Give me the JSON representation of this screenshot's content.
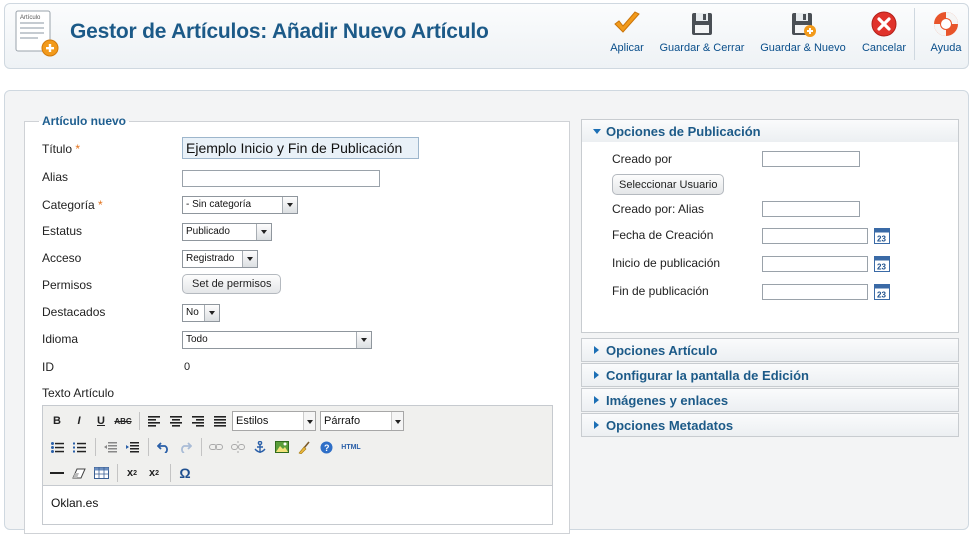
{
  "header": {
    "title": "Gestor de Artículos: Añadir Nuevo Artículo",
    "page_icon_text": "Artículo",
    "toolbar": [
      {
        "id": "apply",
        "label": "Aplicar",
        "icon": "check-icon",
        "color": "#f29a1b"
      },
      {
        "id": "save-close",
        "label": "Guardar & Cerrar",
        "icon": "save-icon"
      },
      {
        "id": "save-new",
        "label": "Guardar & Nuevo",
        "icon": "save-new-icon"
      },
      {
        "id": "cancel",
        "label": "Cancelar",
        "icon": "cancel-icon",
        "color": "#e0322b"
      },
      {
        "id": "help",
        "label": "Ayuda",
        "icon": "lifebuoy-icon",
        "color": "#e8542a"
      }
    ]
  },
  "form": {
    "legend": "Artículo nuevo",
    "title_label": "Título",
    "title_value": "Ejemplo Inicio y Fin de Publicación",
    "alias_label": "Alias",
    "alias_value": "",
    "category_label": "Categoría",
    "category_value": "- Sin categoría",
    "status_label": "Estatus",
    "status_value": "Publicado",
    "access_label": "Acceso",
    "access_value": "Registrado",
    "permissions_label": "Permisos",
    "permissions_button": "Set de permisos",
    "featured_label": "Destacados",
    "featured_value": "No",
    "language_label": "Idioma",
    "language_value": "Todo",
    "id_label": "ID",
    "id_value": "0",
    "article_text_label": "Texto Artículo",
    "required_mark": "*"
  },
  "editor": {
    "styles_select": "Estilos",
    "format_select": "Párrafo",
    "html_label": "HTML",
    "content": "Oklan.es"
  },
  "publishing": {
    "heading": "Opciones de Publicación",
    "created_by_label": "Creado por",
    "select_user_button": "Seleccionar Usuario",
    "created_by_alias_label": "Creado por: Alias",
    "created_date_label": "Fecha de Creación",
    "publish_up_label": "Inicio de publicación",
    "publish_down_label": "Fin de publicación",
    "calendar_text": "23"
  },
  "collapsed_panels": [
    {
      "label": "Opciones Artículo"
    },
    {
      "label": "Configurar la pantalla de Edición"
    },
    {
      "label": "Imágenes y enlaces"
    },
    {
      "label": "Opciones Metadatos"
    }
  ]
}
